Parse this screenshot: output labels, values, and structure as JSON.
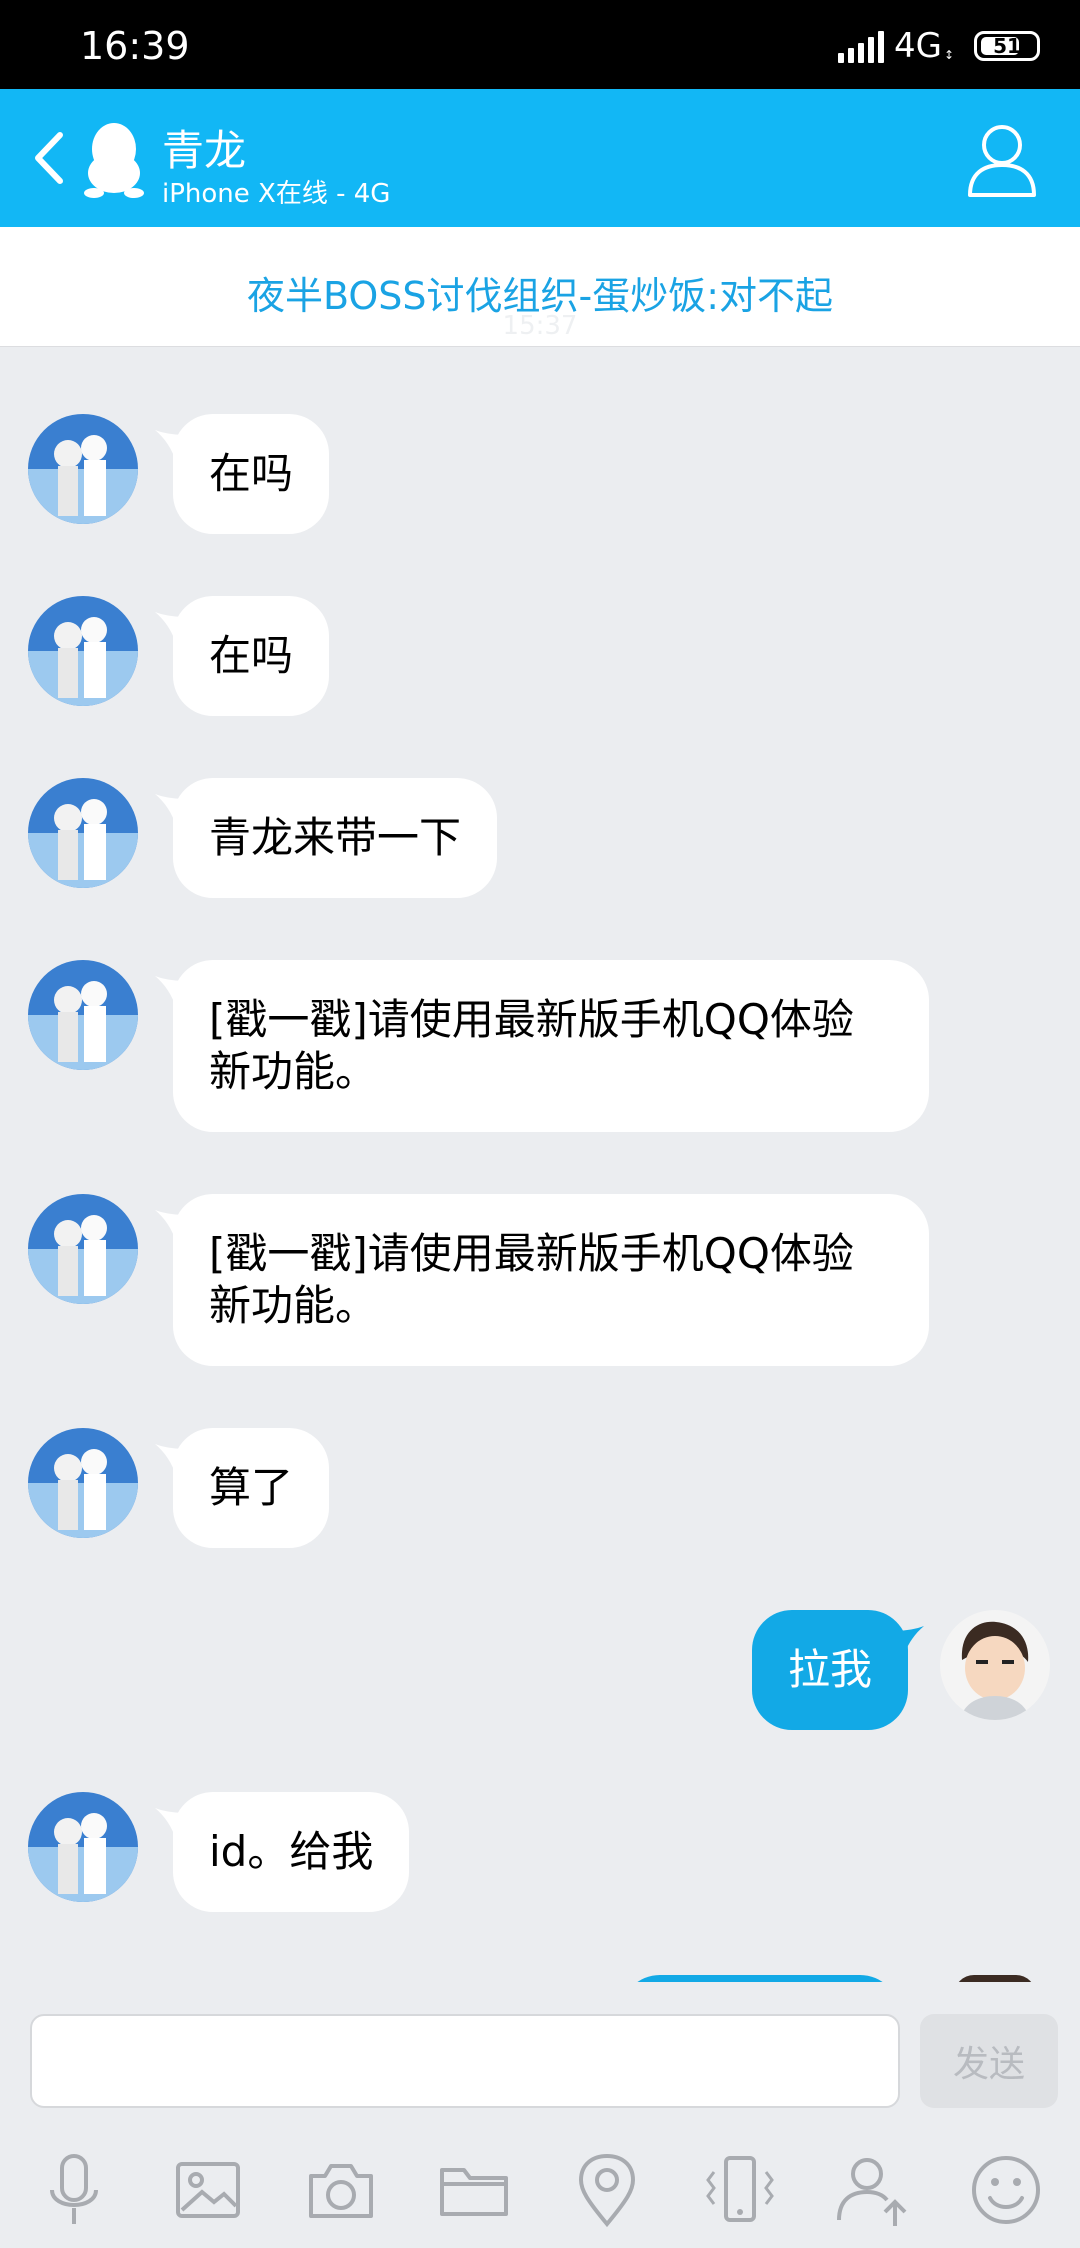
{
  "status_bar": {
    "time": "16:39",
    "network": "4G",
    "battery": "51"
  },
  "header": {
    "contact_name": "青龙",
    "contact_status": "iPhone X在线 - 4G"
  },
  "notice": {
    "text": "夜半BOSS讨伐组织-蛋炒饭:对不起",
    "timestamp": "15:37"
  },
  "messages": [
    {
      "side": "in",
      "text": "在吗"
    },
    {
      "side": "in",
      "text": "在吗"
    },
    {
      "side": "in",
      "text": "青龙来带一下"
    },
    {
      "side": "in",
      "text": "[戳一戳]请使用最新版手机QQ体验新功能。"
    },
    {
      "side": "in",
      "text": "[戳一戳]请使用最新版手机QQ体验新功能。"
    },
    {
      "side": "in",
      "text": "算了"
    },
    {
      "side": "out",
      "text": "拉我"
    },
    {
      "side": "in",
      "text": "id。给我"
    }
  ],
  "input": {
    "placeholder": "",
    "send_label": "发送"
  },
  "toolbar": [
    "microphone-icon",
    "image-icon",
    "camera-icon",
    "folder-icon",
    "location-icon",
    "shake-icon",
    "contact-card-icon",
    "emoji-icon"
  ],
  "colors": {
    "accent": "#12b7f5",
    "outgoing_bubble": "#12a9e6",
    "background": "#ebedf0",
    "notice_text": "#1aa3e4"
  }
}
